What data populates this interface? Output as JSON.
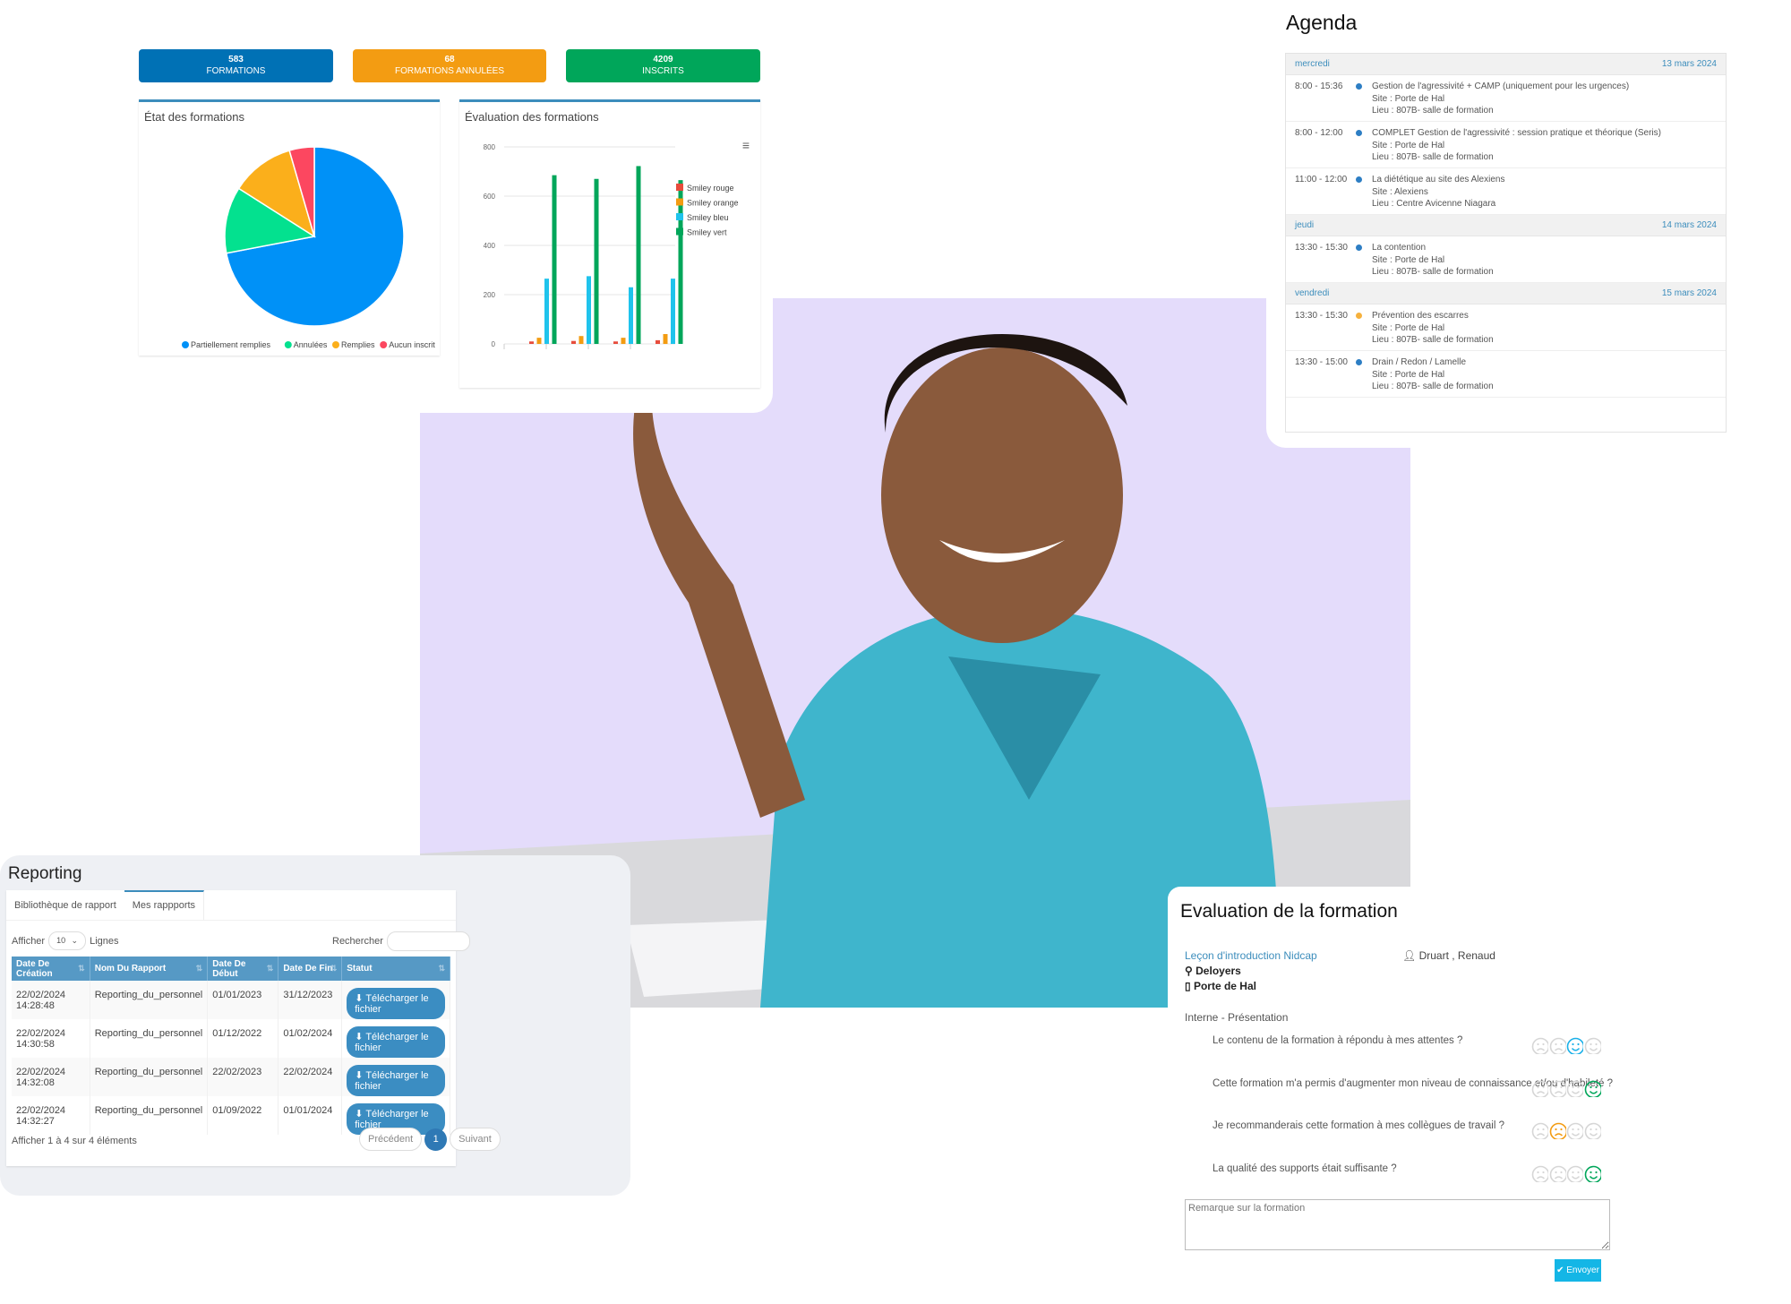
{
  "kpis": [
    {
      "value": "583",
      "label": "FORMATIONS",
      "color": "#0071b5"
    },
    {
      "value": "68",
      "label": "FORMATIONS ANNULÉES",
      "color": "#f39c12"
    },
    {
      "value": "4209",
      "label": "INSCRITS",
      "color": "#00a65a"
    }
  ],
  "pie_card": {
    "title": "État des formations"
  },
  "bar_card": {
    "title": "Évaluation des formations"
  },
  "chart_data": [
    {
      "type": "pie",
      "title": "État des formations",
      "labels": [
        "Partiellement remplies",
        "Annulées",
        "Remplies",
        "Aucun inscrit"
      ],
      "values": [
        72,
        12,
        11.5,
        4.5
      ],
      "colors": [
        "#0091f7",
        "#03e18f",
        "#fbaf1b",
        "#fc4760"
      ],
      "legend": "bottom"
    },
    {
      "type": "bar",
      "title": "Évaluation des formations",
      "categories": [
        "",
        "",
        "",
        ""
      ],
      "ylim": [
        0,
        800
      ],
      "yticks": [
        0,
        200,
        400,
        600,
        800
      ],
      "grid": true,
      "legend": "right",
      "series": [
        {
          "name": "Smiley rouge",
          "color": "#e74c3c",
          "values": [
            10,
            12,
            10,
            15
          ]
        },
        {
          "name": "Smiley orange",
          "color": "#f39c12",
          "values": [
            25,
            32,
            25,
            40
          ]
        },
        {
          "name": "Smiley bleu",
          "color": "#1fc3ec",
          "values": [
            265,
            275,
            230,
            265
          ]
        },
        {
          "name": "Smiley vert",
          "color": "#00a65a",
          "values": [
            685,
            670,
            722,
            665
          ]
        }
      ]
    }
  ],
  "agenda": {
    "title": "Agenda",
    "days": [
      {
        "day": "mercredi",
        "date": "13 mars 2024",
        "events": [
          {
            "time": "8:00 - 15:36",
            "color": "#2d7ec4",
            "title": "Gestion de l'agressivité + CAMP (uniquement pour les urgences)",
            "site": "Site : Porte de Hal",
            "lieu": "Lieu : 807B- salle de formation"
          },
          {
            "time": "8:00 - 12:00",
            "color": "#2d7ec4",
            "title": "COMPLET Gestion de l'agressivité : session pratique et théorique (Seris)",
            "site": "Site : Porte de Hal",
            "lieu": "Lieu : 807B- salle de formation"
          },
          {
            "time": "11:00 - 12:00",
            "color": "#2d7ec4",
            "title": "La diététique au site des Alexiens",
            "site": "Site : Alexiens",
            "lieu": "Lieu : Centre Avicenne Niagara"
          }
        ]
      },
      {
        "day": "jeudi",
        "date": "14 mars 2024",
        "events": [
          {
            "time": "13:30 - 15:30",
            "color": "#2d7ec4",
            "title": "La contention",
            "site": "Site : Porte de Hal",
            "lieu": "Lieu : 807B- salle de formation"
          }
        ]
      },
      {
        "day": "vendredi",
        "date": "15 mars 2024",
        "events": [
          {
            "time": "13:30 - 15:30",
            "color": "#f6b13d",
            "title": "Prévention des escarres",
            "site": "Site : Porte de Hal",
            "lieu": "Lieu : 807B- salle de formation"
          },
          {
            "time": "13:30 - 15:00",
            "color": "#2d7ec4",
            "title": "Drain / Redon / Lamelle",
            "site": "Site : Porte de Hal",
            "lieu": "Lieu : 807B- salle de formation"
          }
        ]
      }
    ]
  },
  "reporting": {
    "title": "Reporting",
    "tabs": [
      "Bibliothèque de rapport",
      "Mes rappports"
    ],
    "show_label": "Afficher",
    "show_value": "10",
    "lines_label": "Lignes",
    "search_label": "Rechercher",
    "search_value": "",
    "columns": [
      "Date De Création",
      "Nom Du Rapport",
      "Date De Début",
      "Date De Fin",
      "Statut"
    ],
    "rows": [
      [
        "22/02/2024 14:28:48",
        "Reporting_du_personnel",
        "01/01/2023",
        "31/12/2023"
      ],
      [
        "22/02/2024 14:30:58",
        "Reporting_du_personnel",
        "01/12/2022",
        "01/02/2024"
      ],
      [
        "22/02/2024 14:32:08",
        "Reporting_du_personnel",
        "22/02/2023",
        "22/02/2024"
      ],
      [
        "22/02/2024 14:32:27",
        "Reporting_du_personnel",
        "01/09/2022",
        "01/01/2024"
      ]
    ],
    "download_label": "Télécharger le fichier",
    "info": "Afficher 1 à 4 sur 4 éléments",
    "prev": "Précédent",
    "page": "1",
    "next": "Suivant"
  },
  "evaluation": {
    "title": "Evaluation de la formation",
    "course": "Leçon d'introduction Nidcap",
    "trainer": "Druart , Renaud",
    "location": "Deloyers",
    "site": "Porte de Hal",
    "section": "Interne - Présentation",
    "questions": [
      {
        "text": "Le contenu de la formation à répondu à mes attentes ?",
        "selected": 3
      },
      {
        "text": "Cette formation m'a permis d'augmenter mon niveau de connaissance et/ou d'habileté ?",
        "selected": 4
      },
      {
        "text": "Je recommanderais cette formation à mes collègues de travail ?",
        "selected": 2
      },
      {
        "text": "La qualité des supports était suffisante ?",
        "selected": 4
      }
    ],
    "smiley_colors": [
      "#e74c3c",
      "#f39c12",
      "#1ab0e8",
      "#00a65a"
    ],
    "remark_placeholder": "Remarque sur la formation",
    "submit": "Envoyer"
  }
}
